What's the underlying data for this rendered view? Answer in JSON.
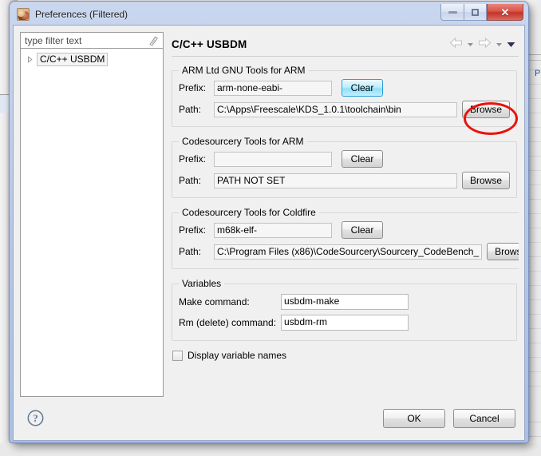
{
  "window": {
    "title": "Preferences (Filtered)",
    "icon": "preferences-icon",
    "controls": {
      "minimize": "minimize-icon",
      "maximize": "maximize-icon",
      "close": "✕"
    }
  },
  "filter": {
    "placeholder": "type filter text",
    "value": "",
    "clear_icon": "clear-filter-icon"
  },
  "tree": {
    "items": [
      {
        "label": "C/C++ USBDM",
        "expander": "▷",
        "selected": true
      }
    ]
  },
  "pane": {
    "title": "C/C++ USBDM",
    "nav": {
      "back_icon": "back-arrow-icon",
      "back_menu_icon": "chevron-down-icon",
      "forward_icon": "forward-arrow-icon",
      "forward_menu_icon": "chevron-down-icon",
      "view_menu_icon": "view-menu-icon"
    }
  },
  "groups": [
    {
      "legend": "ARM Ltd GNU Tools for ARM",
      "prefix_label": "Prefix:",
      "prefix_value": "arm-none-eabi-",
      "path_label": "Path:",
      "path_value": "C:\\Apps\\Freescale\\KDS_1.0.1\\toolchain\\bin",
      "clear_label": "Clear",
      "browse_label": "Browse",
      "clear_hover": true,
      "browse_highlighted": true
    },
    {
      "legend": "Codesourcery Tools for ARM",
      "prefix_label": "Prefix:",
      "prefix_value": "",
      "path_label": "Path:",
      "path_value": "PATH NOT SET",
      "clear_label": "Clear",
      "browse_label": "Browse",
      "clear_hover": false,
      "browse_highlighted": false
    },
    {
      "legend": "Codesourcery Tools for Coldfire",
      "prefix_label": "Prefix:",
      "prefix_value": "m68k-elf-",
      "path_label": "Path:",
      "path_value": "C:\\Program Files (x86)\\CodeSourcery\\Sourcery_CodeBench_",
      "clear_label": "Clear",
      "browse_label": "Browse",
      "clear_hover": false,
      "browse_highlighted": false
    }
  ],
  "variables": {
    "legend": "Variables",
    "make_label": "Make command:",
    "make_value": "usbdm-make",
    "rm_label": "Rm (delete) command:",
    "rm_value": "usbdm-rm"
  },
  "display_variable_names": {
    "label": "Display variable names",
    "checked": false
  },
  "footer": {
    "help_icon": "help-icon",
    "ok_label": "OK",
    "cancel_label": "Cancel"
  },
  "annotation": {
    "shape": "ellipse",
    "color": "#e8130c",
    "target": "browse-button-arm"
  },
  "colors": {
    "titlebar_top": "#c9d6ee",
    "titlebar_bottom": "#aabfe2",
    "dialog_bg": "#f0f0f0",
    "close_button": "#c23429",
    "hover_accent": "#8fe0fb",
    "annotation_red": "#e8130c",
    "group_border": "#d7d7d7"
  }
}
